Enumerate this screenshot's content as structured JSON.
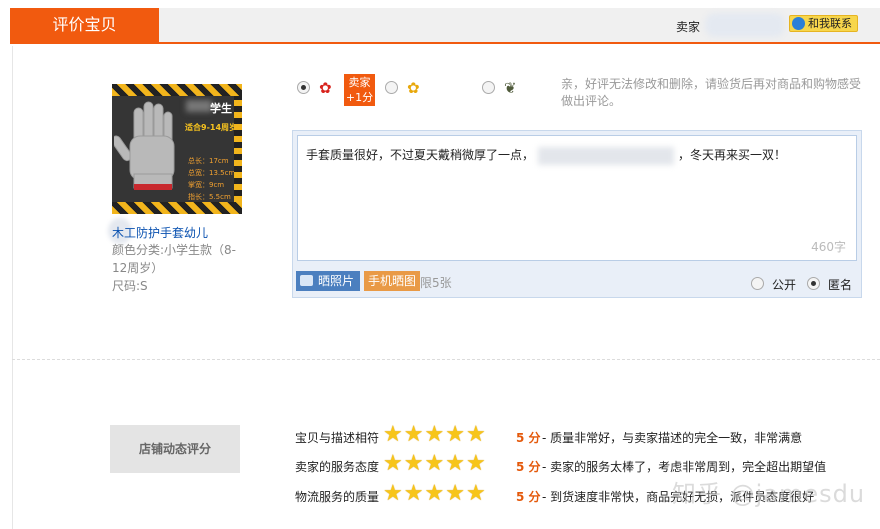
{
  "header": {
    "tab_title": "评价宝贝",
    "seller_label": "卖家",
    "contact_label": "和我联系"
  },
  "product": {
    "name": "木工防护手套幼儿",
    "color_category": "颜色分类:小学生款（8-",
    "color_category_cont": "12周岁）",
    "size": "尺码:S",
    "image_text": {
      "title": "学生",
      "subtitle": "适合9-14周岁",
      "specs": [
        "总长：17cm",
        "总宽：13.5cm",
        "掌宽：9cm",
        "指长：5.5cm"
      ]
    }
  },
  "rating_options": {
    "good_icon": "red-flower-icon",
    "neutral_icon": "yellow-flower-icon",
    "bad_icon": "wilted-flower-icon",
    "bonus_line1": "卖家",
    "bonus_line2": "+1分",
    "selected": "good"
  },
  "hint": "亲，好评无法修改和删除，请验货后再对商品和购物感受做出评论。",
  "review": {
    "text_before": "手套质量很好，不过夏天戴稍微厚了一点，",
    "text_after": "，冬天再来买一双！",
    "char_count": "460字",
    "photo_button": "晒照片",
    "mobile_photo_button": "手机晒图",
    "limit": "限5张",
    "public_label": "公开",
    "anonymous_label": "匿名",
    "visibility": "anonymous"
  },
  "store_rating": {
    "button_label": "店铺动态评分",
    "rows": [
      {
        "label": "宝贝与描述相符",
        "stars": 5,
        "score": "5 分",
        "desc": "- 质量非常好，与卖家描述的完全一致，非常满意"
      },
      {
        "label": "卖家的服务态度",
        "stars": 5,
        "score": "5 分",
        "desc": "- 卖家的服务太棒了，考虑非常周到，完全超出期望值"
      },
      {
        "label": "物流服务的质量",
        "stars": 5,
        "score": "5 分",
        "desc": "- 到货速度非常快，商品完好无损，派件员态度很好"
      }
    ]
  },
  "watermark": "知乎 @jamesdu",
  "colors": {
    "brand_orange": "#f15a0f",
    "star_yellow": "#f7c51a",
    "link_blue": "#0b52b0",
    "score_orange": "#e4590b"
  }
}
